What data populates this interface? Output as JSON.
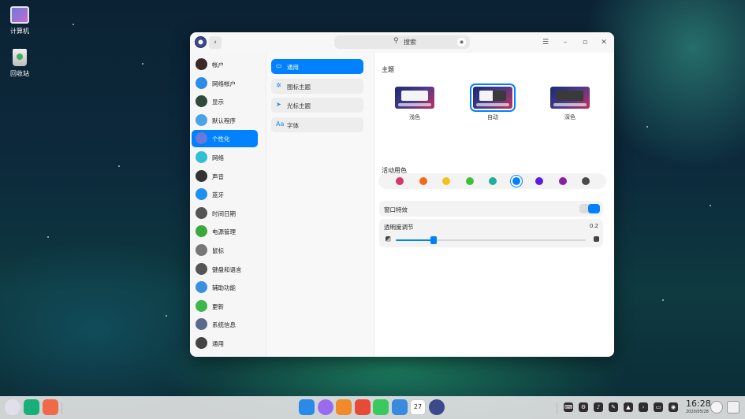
{
  "desktop": {
    "icons": [
      {
        "label": "计算机",
        "icon": "computer-icon"
      },
      {
        "label": "回收站",
        "icon": "trash-icon"
      }
    ]
  },
  "window": {
    "search_placeholder": "搜索",
    "nav": [
      {
        "label": "帐户",
        "icon": "account-icon",
        "color": "#3a2a28"
      },
      {
        "label": "网络帐户",
        "icon": "cloud-account-icon",
        "color": "#2d8ce8"
      },
      {
        "label": "显示",
        "icon": "display-icon",
        "color": "#2e4a3a"
      },
      {
        "label": "默认程序",
        "icon": "default-apps-icon",
        "color": "#4aa3e6"
      },
      {
        "label": "个性化",
        "icon": "personalization-icon",
        "color": "#6a7ad6",
        "active": true
      },
      {
        "label": "网络",
        "icon": "network-icon",
        "color": "#2fc0d8"
      },
      {
        "label": "声音",
        "icon": "sound-icon",
        "color": "#333333"
      },
      {
        "label": "蓝牙",
        "icon": "bluetooth-icon",
        "color": "#1e90f0"
      },
      {
        "label": "时间日期",
        "icon": "clock-icon",
        "color": "#555555"
      },
      {
        "label": "电源管理",
        "icon": "power-icon",
        "color": "#3aa83a"
      },
      {
        "label": "鼠标",
        "icon": "mouse-icon",
        "color": "#777777"
      },
      {
        "label": "键盘和语言",
        "icon": "keyboard-icon",
        "color": "#555555"
      },
      {
        "label": "辅助功能",
        "icon": "accessibility-icon",
        "color": "#3c8ee0"
      },
      {
        "label": "更新",
        "icon": "update-icon",
        "color": "#3cb84a"
      },
      {
        "label": "系统信息",
        "icon": "system-info-icon",
        "color": "#5a6a8a"
      },
      {
        "label": "通用",
        "icon": "general-icon",
        "color": "#444444"
      }
    ],
    "sub_nav": [
      {
        "label": "通用",
        "icon": "window-icon",
        "glyph": "▭",
        "active": true
      },
      {
        "label": "图标主题",
        "icon": "icon-theme-icon",
        "glyph": "✲"
      },
      {
        "label": "光标主题",
        "icon": "cursor-icon",
        "glyph": "➤"
      },
      {
        "label": "字体",
        "icon": "font-icon",
        "glyph": "Aa"
      }
    ],
    "content": {
      "theme_title": "主题",
      "themes": [
        {
          "label": "浅色",
          "style": "light"
        },
        {
          "label": "自动",
          "style": "split",
          "selected": true
        },
        {
          "label": "深色",
          "style": "dark"
        }
      ],
      "accent_title": "活动用色",
      "accent_colors": [
        "#d8366a",
        "#f06a1c",
        "#f2c21a",
        "#3fbf3a",
        "#1eb09a",
        "#0081ff",
        "#5a1ee0",
        "#8a1ea8",
        "#4a4a4a"
      ],
      "accent_selected": 5,
      "window_effect_label": "窗口特效",
      "window_effect_on": true,
      "transparency_label": "透明度调节",
      "transparency_value": "0.2",
      "transparency_level": 0.2
    }
  },
  "dock": {
    "left_apps": [
      {
        "icon": "launcher-icon",
        "color": "#e0e0ea"
      },
      {
        "icon": "multitask-icon",
        "color": "#17b07a"
      },
      {
        "icon": "workspace-icon",
        "color": "#f06a4a"
      }
    ],
    "center_apps": [
      {
        "icon": "app-store-icon",
        "color": "#2a8ae8"
      },
      {
        "icon": "browser-icon",
        "color": "#9a6af0"
      },
      {
        "icon": "file-manager-icon",
        "color": "#f08a2a"
      },
      {
        "icon": "photo-icon",
        "color": "#e84a3a"
      },
      {
        "icon": "music-icon",
        "color": "#3ac860"
      },
      {
        "icon": "document-icon",
        "color": "#3a8ae0"
      },
      {
        "icon": "calendar-icon",
        "color": "#ffffff",
        "text": "27"
      },
      {
        "icon": "control-center-icon",
        "color": "#3a4a8a"
      }
    ],
    "tray": [
      {
        "icon": "keyboard-tray-icon",
        "glyph": "⌨"
      },
      {
        "icon": "network-tray-icon",
        "glyph": "⚙"
      },
      {
        "icon": "volume-icon",
        "glyph": "♪"
      },
      {
        "icon": "pen-icon",
        "glyph": "✎"
      },
      {
        "icon": "notification-icon",
        "glyph": "▲"
      },
      {
        "icon": "expand-icon",
        "glyph": "›"
      },
      {
        "icon": "screen-icon",
        "glyph": "▭"
      },
      {
        "icon": "globe-icon",
        "glyph": "◉"
      }
    ],
    "time": "16:28",
    "date": "2020/05/28",
    "right_apps": [
      {
        "icon": "smiley-icon",
        "color": "#f4f4f4"
      },
      {
        "icon": "trash-dock-icon",
        "color": "#f0f0f0"
      }
    ]
  }
}
